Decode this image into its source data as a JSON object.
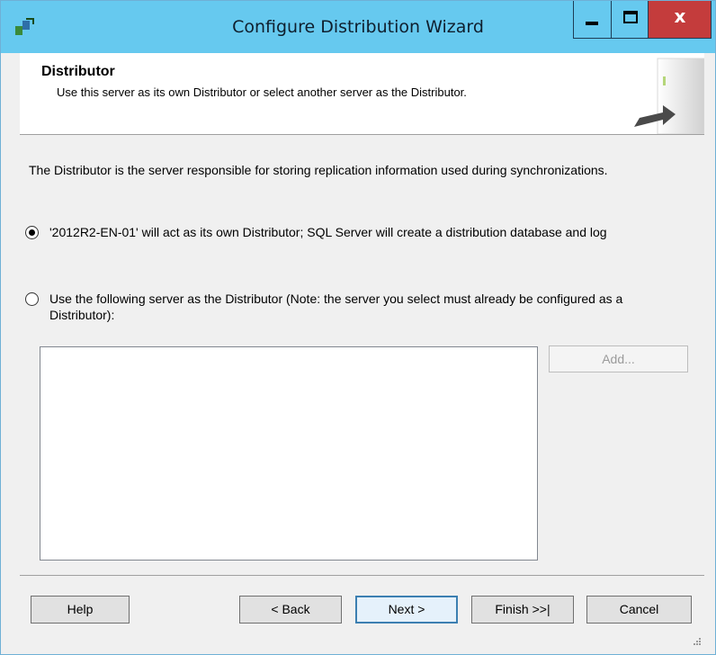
{
  "window": {
    "title": "Configure Distribution Wizard",
    "close_glyph": "x"
  },
  "header": {
    "title": "Distributor",
    "subtitle": "Use this server as its own Distributor or select another server as the Distributor."
  },
  "content": {
    "description": "The Distributor is the server responsible for storing replication information used during synchronizations.",
    "option_own": {
      "label": "'2012R2-EN-01' will act as its own Distributor; SQL Server will create a distribution database and log",
      "selected": true
    },
    "option_other": {
      "label": "Use the following server as the Distributor (Note: the server you select must already be configured as a Distributor):",
      "selected": false
    },
    "add_button": "Add..."
  },
  "footer": {
    "help": "Help",
    "back": "< Back",
    "next": "Next >",
    "finish": "Finish >>|",
    "cancel": "Cancel"
  },
  "colors": {
    "titlebar": "#66c9ef",
    "close_button": "#c43c3c",
    "window_bg": "#f0f0f0"
  },
  "icons": {
    "app": "wizard-app-icon",
    "header": "server-arrow-graphic"
  }
}
